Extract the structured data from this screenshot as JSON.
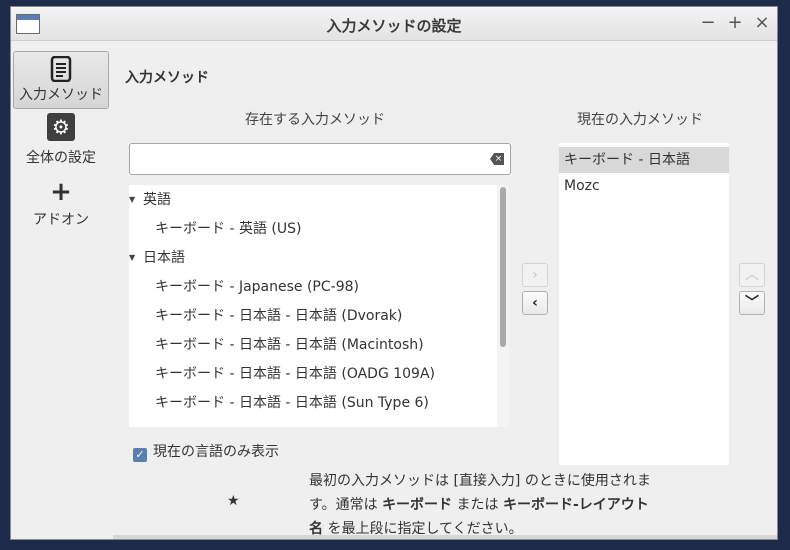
{
  "window": {
    "title": "入力メソッドの設定",
    "minimize_glyph": "−",
    "maximize_glyph": "+",
    "close_glyph": "×"
  },
  "sidebar": {
    "items": [
      {
        "label": "入力メソッド",
        "icon": "document-icon",
        "active": true
      },
      {
        "label": "全体の設定",
        "icon": "gear-icon",
        "active": false
      },
      {
        "label": "アドオン",
        "icon": "plus-icon",
        "active": false
      }
    ]
  },
  "main": {
    "section_title": "入力メソッド",
    "available_header": "存在する入力メソッド",
    "current_header": "現在の入力メソッド",
    "search": {
      "value": "",
      "placeholder": ""
    },
    "available_list": [
      {
        "type": "group",
        "label": "英語"
      },
      {
        "type": "item",
        "label": "キーボード - 英語 (US)"
      },
      {
        "type": "group",
        "label": "日本語"
      },
      {
        "type": "item",
        "label": "キーボード - Japanese (PC-98)"
      },
      {
        "type": "item",
        "label": "キーボード - 日本語 - 日本語 (Dvorak)"
      },
      {
        "type": "item",
        "label": "キーボード - 日本語 - 日本語 (Macintosh)"
      },
      {
        "type": "item",
        "label": "キーボード - 日本語 - 日本語 (OADG 109A)"
      },
      {
        "type": "item",
        "label": "キーボード - 日本語 - 日本語 (Sun Type 6)"
      }
    ],
    "current_list": [
      {
        "label": "キーボード - 日本語",
        "selected": true
      },
      {
        "label": "Mozc",
        "selected": false
      }
    ],
    "buttons": {
      "add_glyph": "›",
      "remove_glyph": "‹",
      "up_glyph": "︿",
      "down_glyph": "﹀"
    },
    "checkbox": {
      "label": "現在の言語のみ表示",
      "checked": true,
      "mark": "✓"
    },
    "note": {
      "star": "★",
      "line1": "最初の入力メソッドは [直接入力] のときに使用されま",
      "line2_pre": "す。通常は ",
      "line2_b1": "キーボード",
      "line2_mid": " または ",
      "line2_b2": "キーボード-レイアウト",
      "line3_b": "名",
      "line3_post": " を最上段に指定してください。"
    }
  },
  "colors": {
    "accent": "#5b7fb0",
    "selection": "#d8d8d8",
    "background": "#efefef"
  }
}
